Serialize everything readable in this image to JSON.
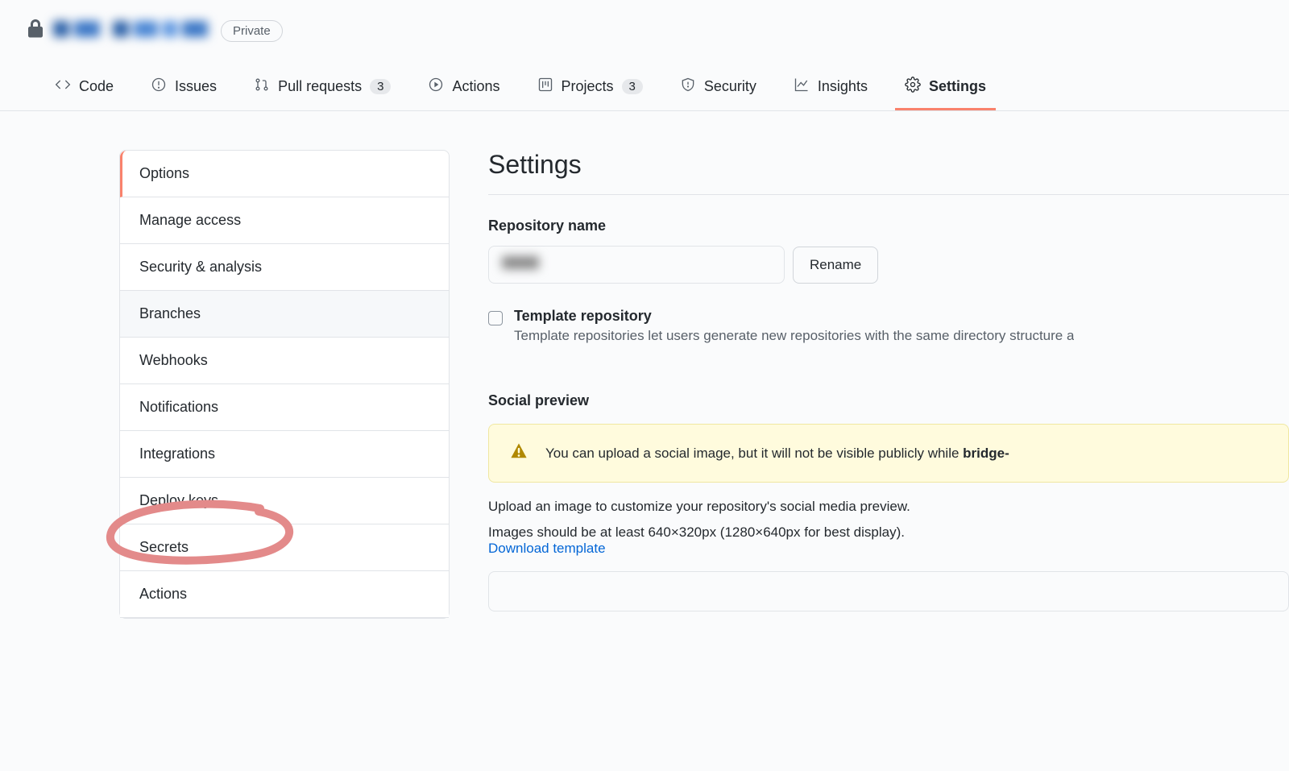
{
  "repo": {
    "visibility": "Private"
  },
  "nav": {
    "code": "Code",
    "issues": "Issues",
    "pull_requests": "Pull requests",
    "pull_requests_count": "3",
    "actions": "Actions",
    "projects": "Projects",
    "projects_count": "3",
    "security": "Security",
    "insights": "Insights",
    "settings": "Settings"
  },
  "sidebar": {
    "items": [
      "Options",
      "Manage access",
      "Security & analysis",
      "Branches",
      "Webhooks",
      "Notifications",
      "Integrations",
      "Deploy keys",
      "Secrets",
      "Actions"
    ]
  },
  "main": {
    "title": "Settings",
    "repo_name_label": "Repository name",
    "rename_button": "Rename",
    "template_checkbox_label": "Template repository",
    "template_checkbox_hint": "Template repositories let users generate new repositories with the same directory structure a",
    "social_preview_heading": "Social preview",
    "social_warning_prefix": "You can upload a social image, but it will not be visible publicly while ",
    "social_warning_bold": "bridge-",
    "upload_hint": "Upload an image to customize your repository's social media preview.",
    "image_hint": "Images should be at least 640×320px (1280×640px for best display).",
    "download_template": "Download template"
  }
}
